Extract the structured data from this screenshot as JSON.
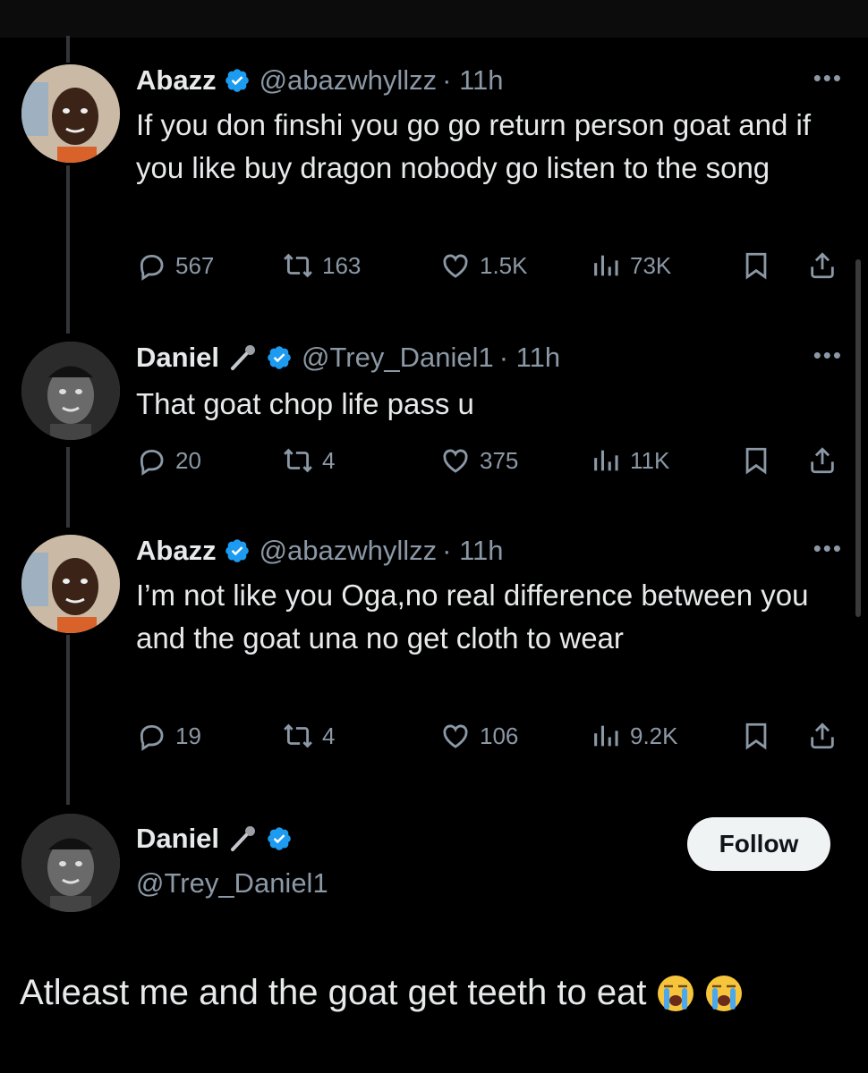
{
  "tweets": [
    {
      "name": "Abazz",
      "handle": "@abazwhyllzz",
      "time": "· 11h",
      "text": "If you don finshi you go go return person goat and if you like buy dragon nobody go listen to the song",
      "replies": "567",
      "retweets": "163",
      "likes": "1.5K",
      "views": "73K"
    },
    {
      "name": "Daniel",
      "handle": "@Trey_Daniel1",
      "time": "· 11h",
      "text": "That goat chop life pass u",
      "replies": "20",
      "retweets": "4",
      "likes": "375",
      "views": "11K"
    },
    {
      "name": "Abazz",
      "handle": "@abazwhyllzz",
      "time": "· 11h",
      "text": "I’m not like you Oga,no real difference between you and the goat una no get cloth to wear",
      "replies": "19",
      "retweets": "4",
      "likes": "106",
      "views": "9.2K"
    }
  ],
  "profile": {
    "name": "Daniel",
    "handle": "@Trey_Daniel1",
    "follow_label": "Follow"
  },
  "reply": {
    "text": "Atleast me and the goat get teeth to eat"
  },
  "icons": {
    "more": "more-icon",
    "verified": "verified-badge-icon",
    "mic": "microphone-icon",
    "reply": "reply-icon",
    "retweet": "retweet-icon",
    "like": "heart-icon",
    "views": "views-icon",
    "bookmark": "bookmark-icon",
    "share": "share-icon",
    "emoji": "loudly-crying-face-icon"
  },
  "colors": {
    "background": "#000000",
    "text": "#e7e9ea",
    "muted": "#8b98a5",
    "verified": "#1d9bf0"
  }
}
